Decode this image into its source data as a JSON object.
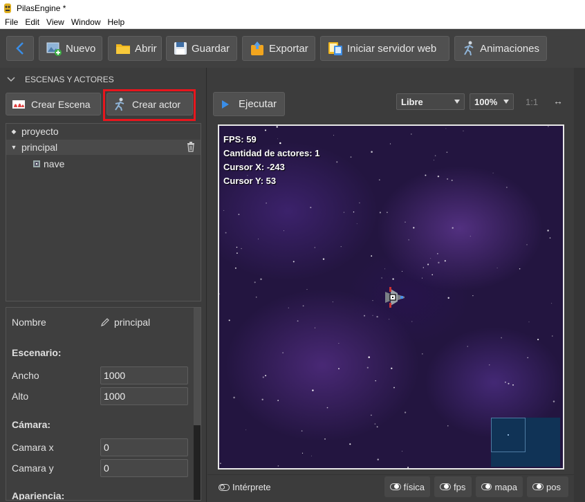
{
  "window": {
    "title": "PilasEngine *"
  },
  "menu": [
    "File",
    "Edit",
    "View",
    "Window",
    "Help"
  ],
  "toolbar": {
    "nuevo": "Nuevo",
    "abrir": "Abrir",
    "guardar": "Guardar",
    "exportar": "Exportar",
    "servidor": "Iniciar servidor web",
    "animaciones": "Animaciones"
  },
  "left": {
    "section_title": "ESCENAS Y ACTORES",
    "crear_escena": "Crear Escena",
    "crear_actor": "Crear actor",
    "tree": [
      {
        "label": "proyecto",
        "mark": "◆"
      },
      {
        "label": "principal",
        "mark": "▼"
      },
      {
        "label": "nave",
        "mark": ""
      }
    ]
  },
  "props": {
    "nombre_label": "Nombre",
    "nombre_value": "principal",
    "escenario_title": "Escenario:",
    "ancho_label": "Ancho",
    "ancho_value": "1000",
    "alto_label": "Alto",
    "alto_value": "1000",
    "camara_title": "Cámara:",
    "camara_x_label": "Camara x",
    "camara_x_value": "0",
    "camara_y_label": "Camara y",
    "camara_y_value": "0",
    "apariencia_title": "Apariencia:"
  },
  "editor": {
    "ejecutar": "Ejecutar",
    "mode": "Libre",
    "zoom": "100%",
    "ratio": "1:1",
    "expand": "↔"
  },
  "hud": {
    "fps": "FPS: 59",
    "actores": "Cantidad de actores: 1",
    "cursor_x": "Cursor X: -243",
    "cursor_y": "Cursor Y: 53"
  },
  "bottom": {
    "interprete": "Intérprete",
    "fisica": "física",
    "fps": "fps",
    "mapa": "mapa",
    "pos": "pos"
  },
  "colors": {
    "accent": "#3a8ee8",
    "highlight": "#e8161d",
    "canvas_bg": "#231540"
  }
}
